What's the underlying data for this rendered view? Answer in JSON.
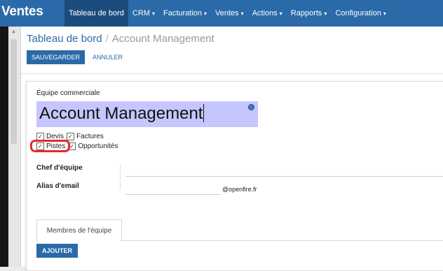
{
  "app": {
    "title": "Ventes"
  },
  "menu": [
    {
      "label": "Tableau de bord",
      "caret": ""
    },
    {
      "label": "CRM",
      "caret": "▾"
    },
    {
      "label": "Facturation",
      "caret": "▾"
    },
    {
      "label": "Ventes",
      "caret": "▾"
    },
    {
      "label": "Actions",
      "caret": "▾"
    },
    {
      "label": "Rapports",
      "caret": "▾"
    },
    {
      "label": "Configuration",
      "caret": "▾"
    }
  ],
  "breadcrumb": {
    "parent": "Tableau de bord",
    "separator": "/",
    "current": "Account Management"
  },
  "toolbar": {
    "save_label": "SAUVEGARDER",
    "cancel_label": "ANNULER"
  },
  "form": {
    "team_label": "Équipe commerciale",
    "team_name": "Account Management",
    "options": [
      {
        "label": "Devis",
        "checked": true
      },
      {
        "label": "Factures",
        "checked": true
      },
      {
        "label": "Pistes",
        "checked": true
      },
      {
        "label": "Opportunités",
        "checked": true
      }
    ],
    "team_leader_label": "Chef d'équipe",
    "team_leader_value": "",
    "email_alias_label": "Alias d'email",
    "email_alias_value": "",
    "email_alias_domain": "@openfire.fr"
  },
  "tabs": [
    {
      "label": "Membres de l'équipe"
    }
  ],
  "members": {
    "add_label": "AJOUTER"
  },
  "colors": {
    "topbar": "#2a6aa8",
    "active_menu": "#1b4c7d",
    "primary": "#2a6aa8",
    "highlight": "#e02b2b",
    "name_field": "#c6c6ff"
  }
}
